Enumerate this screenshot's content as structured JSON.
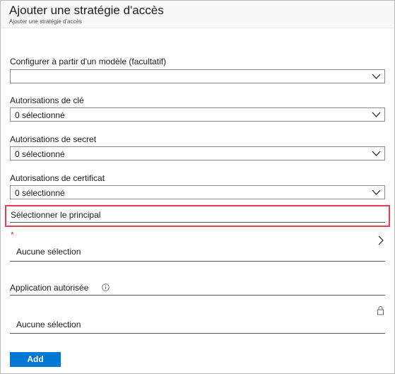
{
  "header": {
    "title": "Ajouter une stratégie d'accès",
    "subtitle": "Ajouter une stratégie d'accès"
  },
  "form": {
    "template": {
      "label": "Configurer à partir d'un modèle (facultatif)",
      "value": ""
    },
    "key_permissions": {
      "label": "Autorisations de clé",
      "value": "0 sélectionné"
    },
    "secret_permissions": {
      "label": "Autorisations de secret",
      "value": "0 sélectionné"
    },
    "certificate_permissions": {
      "label": "Autorisations de certificat",
      "value": "0 sélectionné"
    },
    "principal": {
      "label": "Sélectionner le principal",
      "required_marker": "*",
      "value": "Aucune sélection"
    },
    "authorized_application": {
      "label": "Application autorisée",
      "value": "Aucune sélection"
    }
  },
  "actions": {
    "add_label": "Add"
  },
  "colors": {
    "accent": "#0078d4",
    "highlight": "#e2404d",
    "required": "#d13438"
  },
  "icons": {
    "dropdown": "chevron-down-icon",
    "navigate": "chevron-right-icon",
    "info": "info-icon",
    "lock": "lock-icon"
  }
}
